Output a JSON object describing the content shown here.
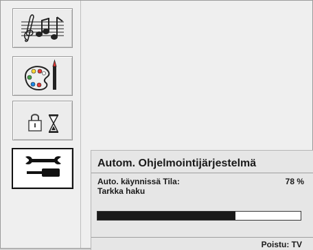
{
  "menu": {
    "items": [
      {
        "icon": "music-notes-icon",
        "selected": false
      },
      {
        "icon": "paint-palette-icon",
        "selected": false
      },
      {
        "icon": "lock-timer-icon",
        "selected": false
      },
      {
        "icon": "tools-icon",
        "selected": true
      }
    ]
  },
  "dialog": {
    "title": "Autom. Ohjelmointijärjestelmä",
    "status_label": "Auto. käynnissä Tila:",
    "percent_text": "78 %",
    "progress_fraction": 0.68,
    "search_mode": "Tarkka haku",
    "exit_hint": "Poistu: TV"
  },
  "colors": {
    "accent": "#1a1a1a",
    "background": "#efefef",
    "palette_red": "#e53935",
    "palette_blue": "#1e88e5",
    "palette_yellow": "#fdd835",
    "palette_green": "#43a047"
  }
}
